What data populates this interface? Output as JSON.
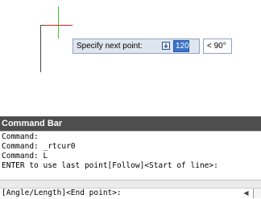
{
  "prompt": {
    "label": "Specify next point:",
    "length_value": "120",
    "angle_value": "< 90°"
  },
  "command_bar": {
    "title": "Command Bar",
    "history": [
      "Command:",
      "Command: _rtcur0",
      "Command: L",
      "ENTER to use last point[Follow]<Start of line>:"
    ],
    "input": "[Angle/Length]<End point>:"
  },
  "icons": {
    "prompt_icon": "keyboard-input-icon",
    "scroll_left": "scroll-left-icon"
  }
}
